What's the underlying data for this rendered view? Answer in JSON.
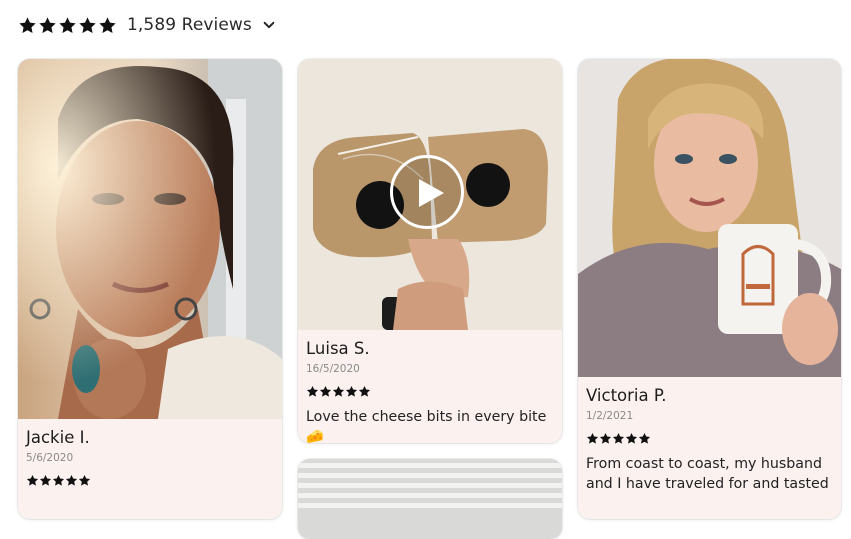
{
  "summary": {
    "rating_stars": 5,
    "reviews_label": "1,589 Reviews"
  },
  "reviews": [
    {
      "name": "Jackie I.",
      "date": "5/6/2020",
      "stars": 5,
      "text": ""
    },
    {
      "name": "Luisa S.",
      "date": "16/5/2020",
      "stars": 5,
      "text": "Love the cheese bits in every bite 🧀"
    },
    {
      "name": "Victoria P.",
      "date": "1/2/2021",
      "stars": 5,
      "text": "From coast to coast, my husband and I have traveled for and tasted"
    }
  ],
  "colors": {
    "card_background": "#fbf1ef",
    "star": "#111111",
    "muted_text": "#8a8a8a"
  },
  "icons": {
    "rating": "star-icon",
    "dropdown": "chevron-down-icon",
    "video": "play-icon"
  }
}
